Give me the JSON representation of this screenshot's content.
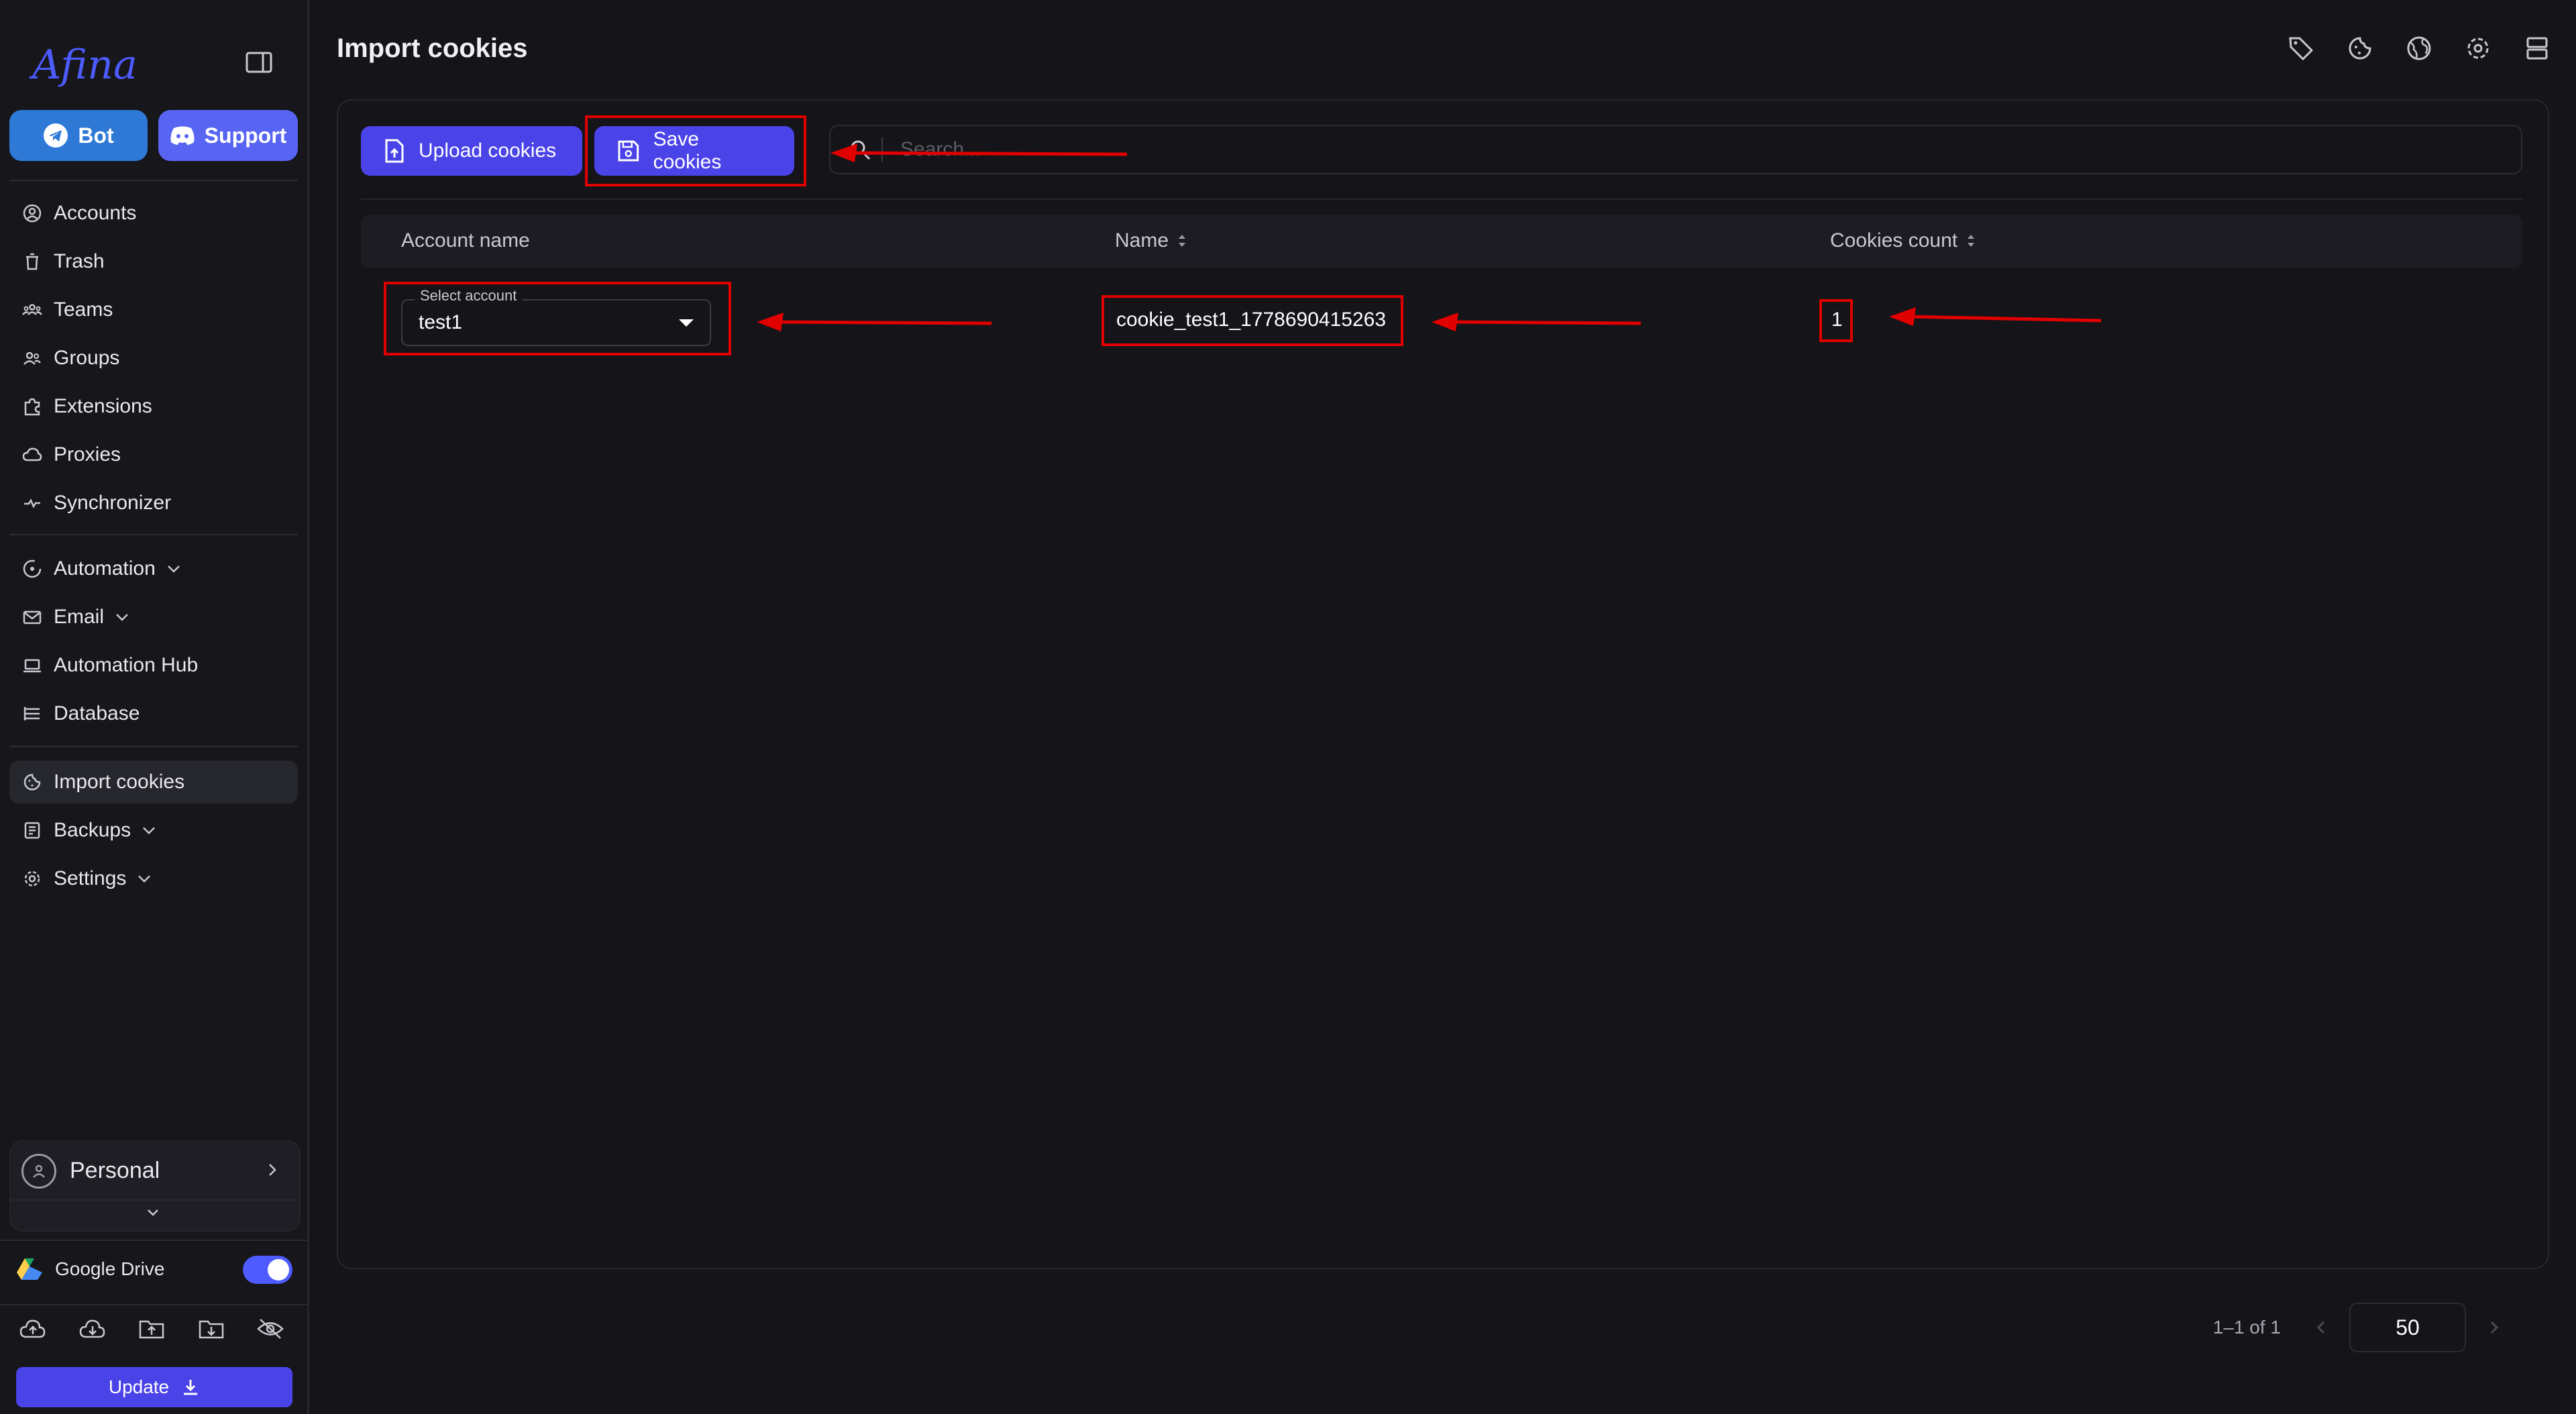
{
  "app": {
    "logo_text": "Afina"
  },
  "sidebar": {
    "bot_label": "Bot",
    "support_label": "Support",
    "items": [
      {
        "label": "Accounts",
        "icon": "account-circle-icon"
      },
      {
        "label": "Trash",
        "icon": "trash-icon"
      },
      {
        "label": "Teams",
        "icon": "teams-icon"
      },
      {
        "label": "Groups",
        "icon": "groups-icon"
      },
      {
        "label": "Extensions",
        "icon": "puzzle-icon"
      },
      {
        "label": "Proxies",
        "icon": "cloud-icon"
      },
      {
        "label": "Synchronizer",
        "icon": "sync-icon"
      },
      {
        "label": "Automation",
        "icon": "automation-icon"
      },
      {
        "label": "Email",
        "icon": "mail-icon"
      },
      {
        "label": "Automation Hub",
        "icon": "laptop-icon"
      },
      {
        "label": "Database",
        "icon": "database-icon"
      },
      {
        "label": "Import cookies",
        "icon": "cookie-icon"
      },
      {
        "label": "Backups",
        "icon": "backup-icon"
      },
      {
        "label": "Settings",
        "icon": "gear-icon"
      }
    ],
    "workspace_label": "Personal",
    "gdrive_label": "Google Drive",
    "gdrive_enabled": true,
    "update_label": "Update"
  },
  "page": {
    "title": "Import cookies"
  },
  "toolbar": {
    "upload_label": "Upload cookies",
    "save_label": "Save cookies",
    "search_placeholder": "Search..."
  },
  "table": {
    "columns": [
      "Account name",
      "Name",
      "Cookies count"
    ],
    "rows": [
      {
        "select_legend": "Select account",
        "account": "test1",
        "name": "cookie_test1_1778690415263",
        "count": "1"
      }
    ]
  },
  "pagination": {
    "range": "1–1 of 1",
    "page_size": "50"
  },
  "colors": {
    "accent": "#4a43e8",
    "annotation": "#e00000",
    "background": "#141419"
  }
}
